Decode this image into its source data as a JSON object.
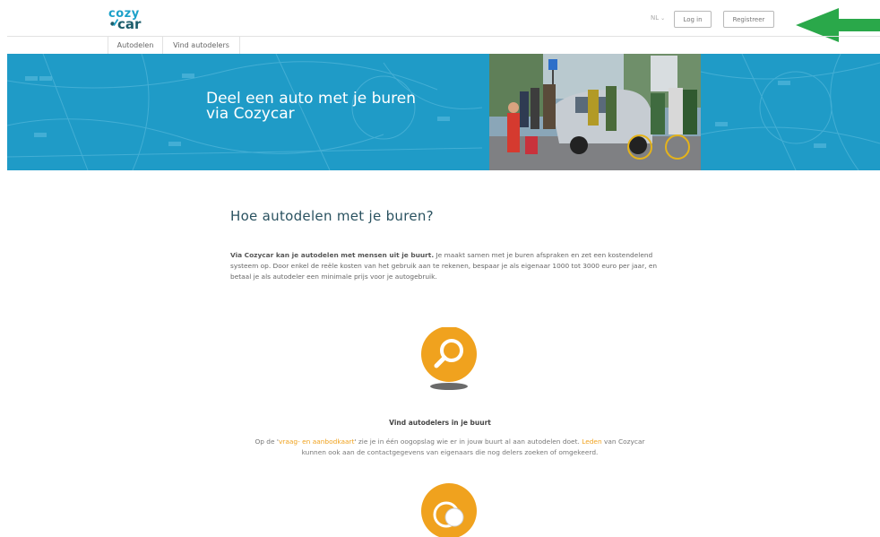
{
  "header": {
    "logo": {
      "line1": "cozy",
      "line2": "car"
    },
    "language": "NL",
    "login_label": "Log in",
    "register_label": "Registreer"
  },
  "nav": {
    "tabs": [
      {
        "label": "Autodelen"
      },
      {
        "label": "Vind autodelers"
      }
    ]
  },
  "hero": {
    "title": "Deel een auto met je buren via Cozycar"
  },
  "main": {
    "heading": "Hoe autodelen met je buren?",
    "intro_bold": "Via Cozycar kan je autodelen met mensen uit je buurt.",
    "intro_rest": " Je maakt samen met je buren afspraken en zet een kostendelend systeem op. Door enkel de reële kosten van het gebruik aan te rekenen, bespaar je als eigenaar 1000 tot 3000 euro per jaar, en betaal je als autodeler een minimale prijs voor je autogebruik.",
    "step1": {
      "title": "Vind autodelers in je buurt",
      "text_pre": "Op de '",
      "link1": "vraag- en aanbodkaart",
      "text_mid": "' zie je in één oogopslag wie er in jouw buurt al aan autodelen doet. ",
      "link2": "Leden",
      "text_post": " van Cozycar kunnen ook aan de contactgegevens van eigenaars die nog delers zoeken of omgekeerd."
    }
  },
  "colors": {
    "brand_blue": "#1f9bc7",
    "brand_dark": "#1c5d6b",
    "accent_orange": "#f0a21e",
    "arrow_green": "#2aa84a"
  }
}
